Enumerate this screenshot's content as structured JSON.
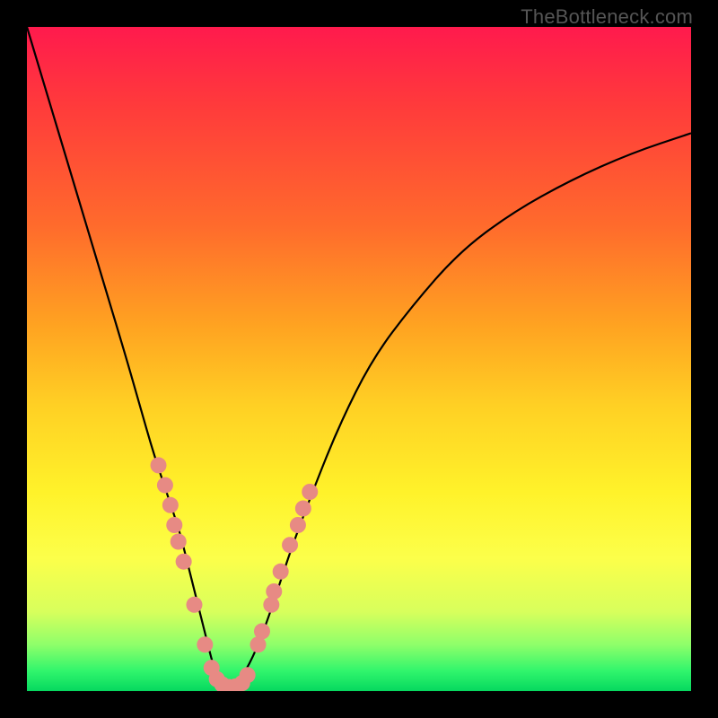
{
  "watermark": "TheBottleneck.com",
  "colors": {
    "curve": "#000000",
    "dot_fill": "#e78a84",
    "dot_stroke": "#c96d66",
    "green_band": "#06d85f"
  },
  "chart_data": {
    "type": "line",
    "title": "",
    "xlabel": "",
    "ylabel": "",
    "xlim": [
      0,
      100
    ],
    "ylim": [
      0,
      100
    ],
    "grid": false,
    "legend": false,
    "series": [
      {
        "name": "bottleneck-curve",
        "x": [
          0,
          3,
          6,
          9,
          12,
          15,
          17,
          19,
          21,
          23,
          24,
          25.5,
          27,
          28,
          29,
          30.5,
          32,
          34,
          36,
          38,
          40,
          43,
          47,
          52,
          58,
          65,
          73,
          82,
          91,
          100
        ],
        "y": [
          100,
          90,
          80,
          70,
          60,
          50,
          43,
          36,
          30,
          24,
          20,
          14,
          8,
          4,
          1.5,
          0.5,
          1.5,
          5,
          10,
          16,
          22,
          30,
          40,
          50,
          58,
          66,
          72,
          77,
          81,
          84
        ]
      }
    ],
    "markers": {
      "name": "sample-points",
      "points": [
        {
          "x": 19.8,
          "y": 34
        },
        {
          "x": 20.8,
          "y": 31
        },
        {
          "x": 21.6,
          "y": 28
        },
        {
          "x": 22.2,
          "y": 25
        },
        {
          "x": 22.8,
          "y": 22.5
        },
        {
          "x": 23.6,
          "y": 19.5
        },
        {
          "x": 25.2,
          "y": 13
        },
        {
          "x": 26.8,
          "y": 7
        },
        {
          "x": 27.8,
          "y": 3.5
        },
        {
          "x": 28.6,
          "y": 1.8
        },
        {
          "x": 29.4,
          "y": 1.0
        },
        {
          "x": 30.4,
          "y": 0.6
        },
        {
          "x": 31.4,
          "y": 0.7
        },
        {
          "x": 32.4,
          "y": 1.2
        },
        {
          "x": 33.2,
          "y": 2.4
        },
        {
          "x": 34.8,
          "y": 7
        },
        {
          "x": 35.4,
          "y": 9
        },
        {
          "x": 36.8,
          "y": 13
        },
        {
          "x": 37.2,
          "y": 15
        },
        {
          "x": 38.2,
          "y": 18
        },
        {
          "x": 39.6,
          "y": 22
        },
        {
          "x": 40.8,
          "y": 25
        },
        {
          "x": 41.6,
          "y": 27.5
        },
        {
          "x": 42.6,
          "y": 30
        }
      ],
      "radius": 9
    }
  }
}
